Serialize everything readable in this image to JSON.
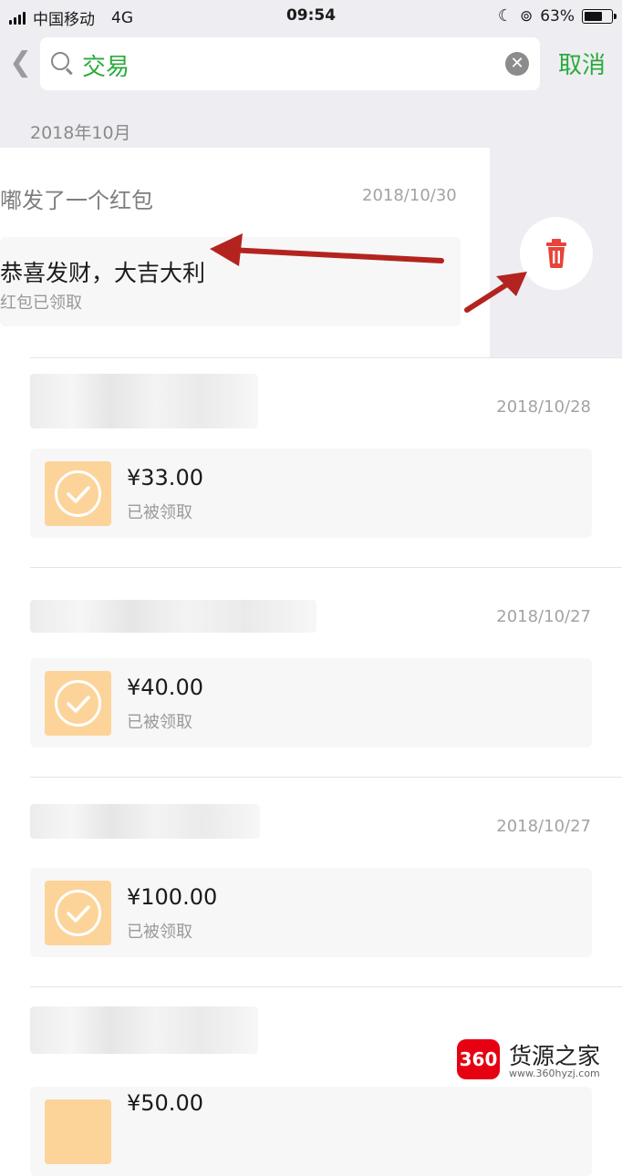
{
  "status_bar": {
    "carrier": "中国移动",
    "network": "4G",
    "time": "09:54",
    "battery": "63%"
  },
  "search": {
    "query": "交易",
    "cancel_label": "取消"
  },
  "month_header": "2018年10月",
  "swiped_entry": {
    "title": "嘟发了一个红包",
    "date": "2018/10/30",
    "message": "恭喜发财，大吉大利",
    "status": "红包已领取"
  },
  "entries": [
    {
      "date": "2018/10/28",
      "amount": "¥33.00",
      "status": "已被领取"
    },
    {
      "date": "2018/10/27",
      "amount": "¥40.00",
      "status": "已被领取"
    },
    {
      "date": "2018/10/27",
      "amount": "¥100.00",
      "status": "已被领取"
    },
    {
      "date": "",
      "amount": "¥50.00",
      "status": ""
    }
  ],
  "watermark": {
    "logo": "360",
    "name": "货源之家",
    "url": "www.360hyzj.com"
  },
  "colors": {
    "accent_green": "#2aab3d",
    "delete_red": "#e8433a",
    "annotation_arrow": "#b3241f",
    "redpacket_icon": "#fcd49a"
  }
}
